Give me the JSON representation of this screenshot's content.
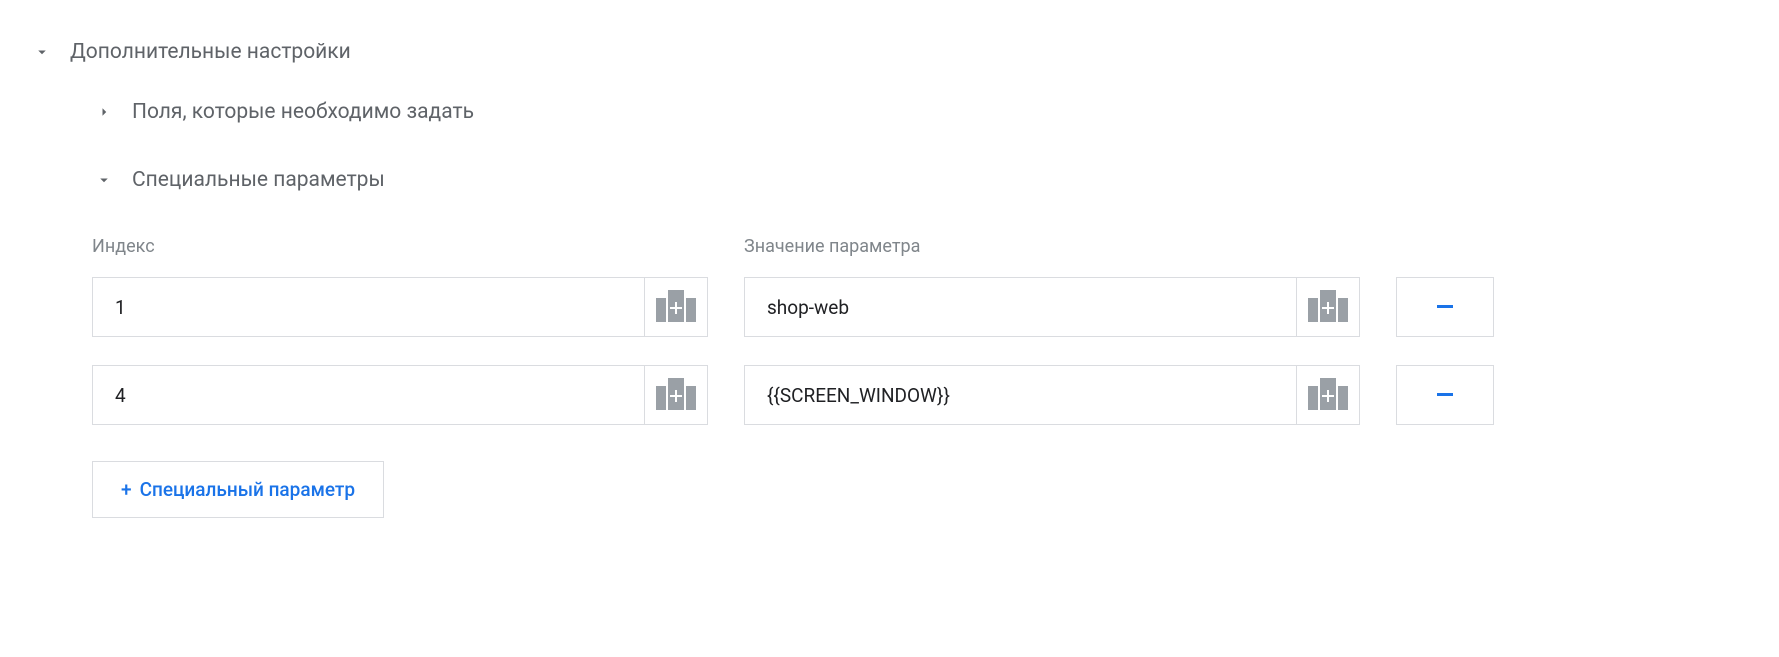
{
  "sections": {
    "advanced": {
      "title": "Дополнительные настройки",
      "expanded": true,
      "fields_to_set": {
        "title": "Поля, которые необходимо задать",
        "expanded": false
      },
      "custom_dimensions": {
        "title": "Специальные параметры",
        "expanded": true,
        "columns": {
          "index": "Индекс",
          "value": "Значение параметра"
        },
        "rows": [
          {
            "index": "1",
            "value": "shop-web"
          },
          {
            "index": "4",
            "value": "{{SCREEN_WINDOW}}"
          }
        ],
        "add_label": "Специальный параметр",
        "remove_label": "-"
      }
    }
  }
}
